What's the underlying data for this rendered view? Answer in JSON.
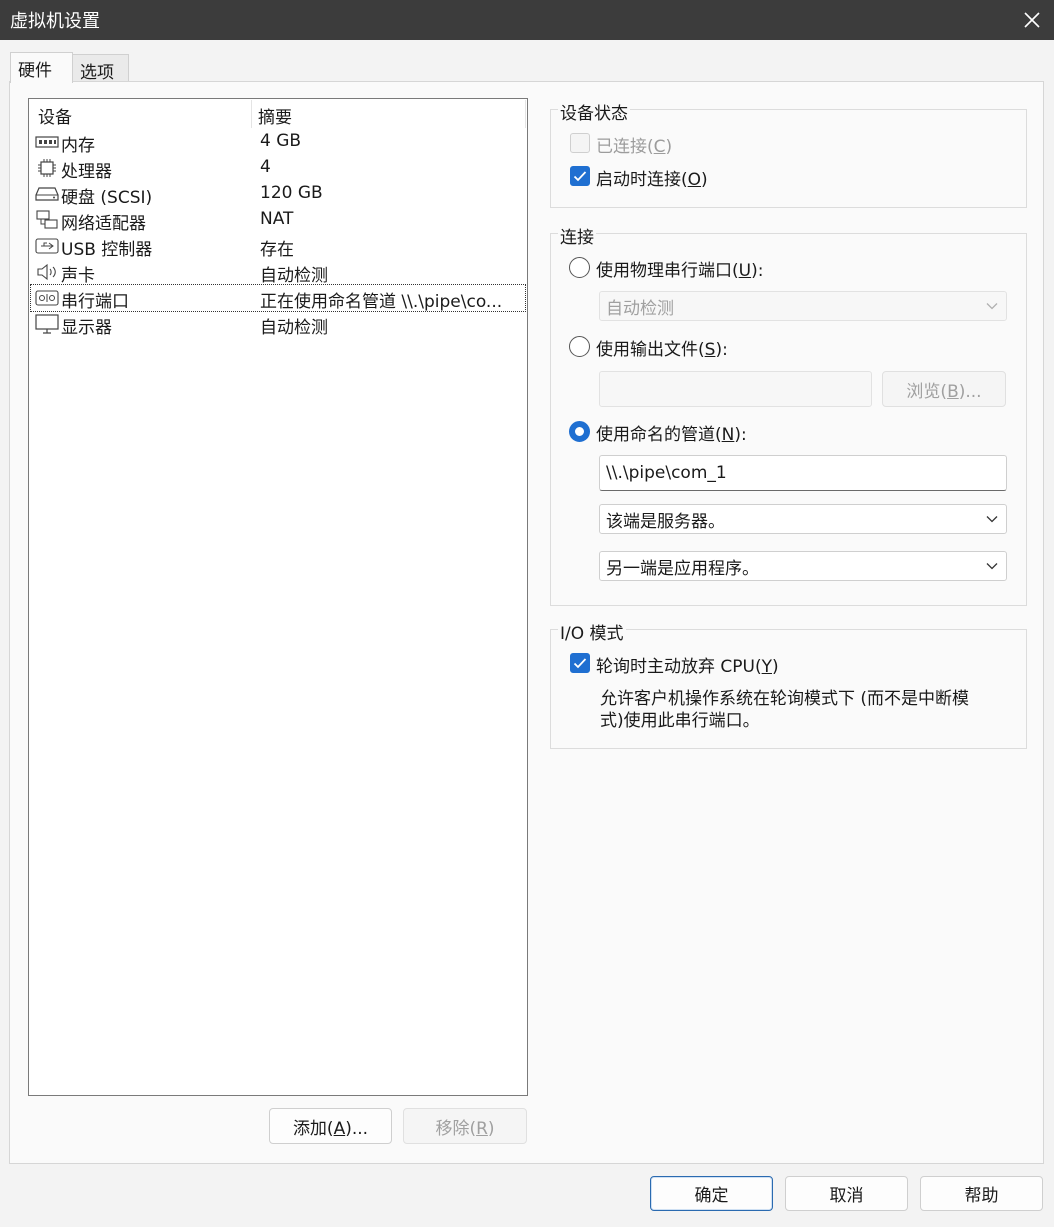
{
  "window": {
    "title": "虚拟机设置",
    "close_icon": "close-icon"
  },
  "tabs": [
    {
      "label": "硬件",
      "active": true
    },
    {
      "label": "选项",
      "active": false
    }
  ],
  "device_list": {
    "columns": [
      "设备",
      "摘要"
    ],
    "rows": [
      {
        "icon": "memory-icon",
        "device": "内存",
        "summary": "4 GB"
      },
      {
        "icon": "processor-icon",
        "device": "处理器",
        "summary": "4"
      },
      {
        "icon": "hard-disk-icon",
        "device": "硬盘 (SCSI)",
        "summary": "120 GB"
      },
      {
        "icon": "network-adapter-icon",
        "device": "网络适配器",
        "summary": "NAT"
      },
      {
        "icon": "usb-icon",
        "device": "USB 控制器",
        "summary": "存在"
      },
      {
        "icon": "sound-card-icon",
        "device": "声卡",
        "summary": "自动检测"
      },
      {
        "icon": "serial-port-icon",
        "device": "串行端口",
        "summary": "正在使用命名管道 \\\\.\\pipe\\co...",
        "selected": true
      },
      {
        "icon": "display-icon",
        "device": "显示器",
        "summary": "自动检测"
      }
    ]
  },
  "list_buttons": {
    "add_prefix": "添加(",
    "add_key": "A",
    "add_suffix": ")...",
    "remove_prefix": "移除(",
    "remove_key": "R",
    "remove_suffix": ")"
  },
  "device_status": {
    "title": "设备状态",
    "connected": {
      "prefix": "已连接(",
      "key": "C",
      "suffix": ")",
      "checked": false,
      "enabled": false
    },
    "connect_at_power_on": {
      "prefix": "启动时连接(",
      "key": "O",
      "suffix": ")",
      "checked": true,
      "enabled": true
    }
  },
  "connection": {
    "title": "连接",
    "physical": {
      "prefix": "使用物理串行端口(",
      "key": "U",
      "suffix": "):",
      "selected": false,
      "select_value": "自动检测"
    },
    "output_file": {
      "prefix": "使用输出文件(",
      "key": "S",
      "suffix": "):",
      "selected": false,
      "file_value": "",
      "browse_prefix": "浏览(",
      "browse_key": "B",
      "browse_suffix": ")..."
    },
    "named_pipe": {
      "prefix": "使用命名的管道(",
      "key": "N",
      "suffix": "):",
      "selected": true,
      "pipe_value": "\\\\.\\pipe\\com_1",
      "end_value": "该端是服务器。",
      "other_end_value": "另一端是应用程序。"
    }
  },
  "io_mode": {
    "title": "I/O 模式",
    "yield_cpu": {
      "prefix": "轮询时主动放弃 CPU(",
      "key": "Y",
      "suffix": ")",
      "checked": true
    },
    "description_line1": "允许客户机操作系统在轮询模式下 (而不是中断模",
    "description_line2": "式)使用此串行端口。"
  },
  "dialog_buttons": {
    "ok": "确定",
    "cancel": "取消",
    "help": "帮助"
  },
  "colors": {
    "accent": "#1f6fd1",
    "titlebar": "#3c3c3c"
  }
}
